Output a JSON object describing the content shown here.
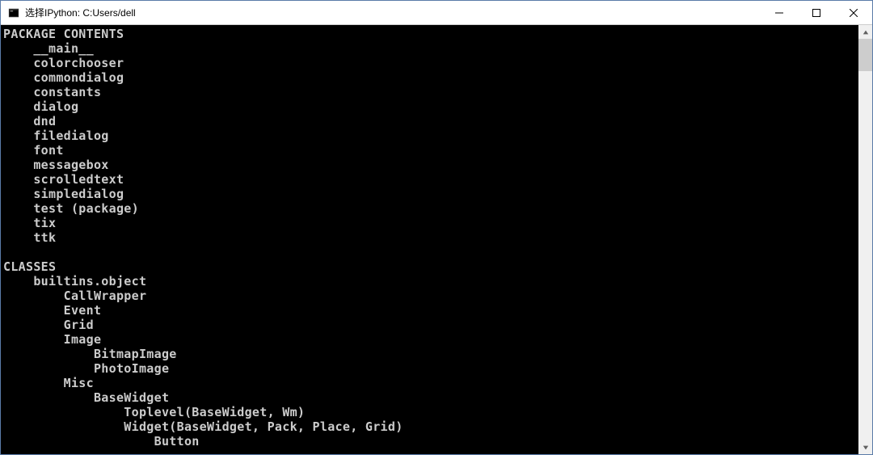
{
  "window": {
    "title": "选择IPython: C:Users/dell"
  },
  "terminal": {
    "lines": [
      "PACKAGE CONTENTS",
      "    __main__",
      "    colorchooser",
      "    commondialog",
      "    constants",
      "    dialog",
      "    dnd",
      "    filedialog",
      "    font",
      "    messagebox",
      "    scrolledtext",
      "    simpledialog",
      "    test (package)",
      "    tix",
      "    ttk",
      "",
      "CLASSES",
      "    builtins.object",
      "        CallWrapper",
      "        Event",
      "        Grid",
      "        Image",
      "            BitmapImage",
      "            PhotoImage",
      "        Misc",
      "            BaseWidget",
      "                Toplevel(BaseWidget, Wm)",
      "                Widget(BaseWidget, Pack, Place, Grid)",
      "                    Button"
    ]
  },
  "scrollbar": {
    "thumb_top_pct": 0,
    "thumb_height_pct": 8
  }
}
